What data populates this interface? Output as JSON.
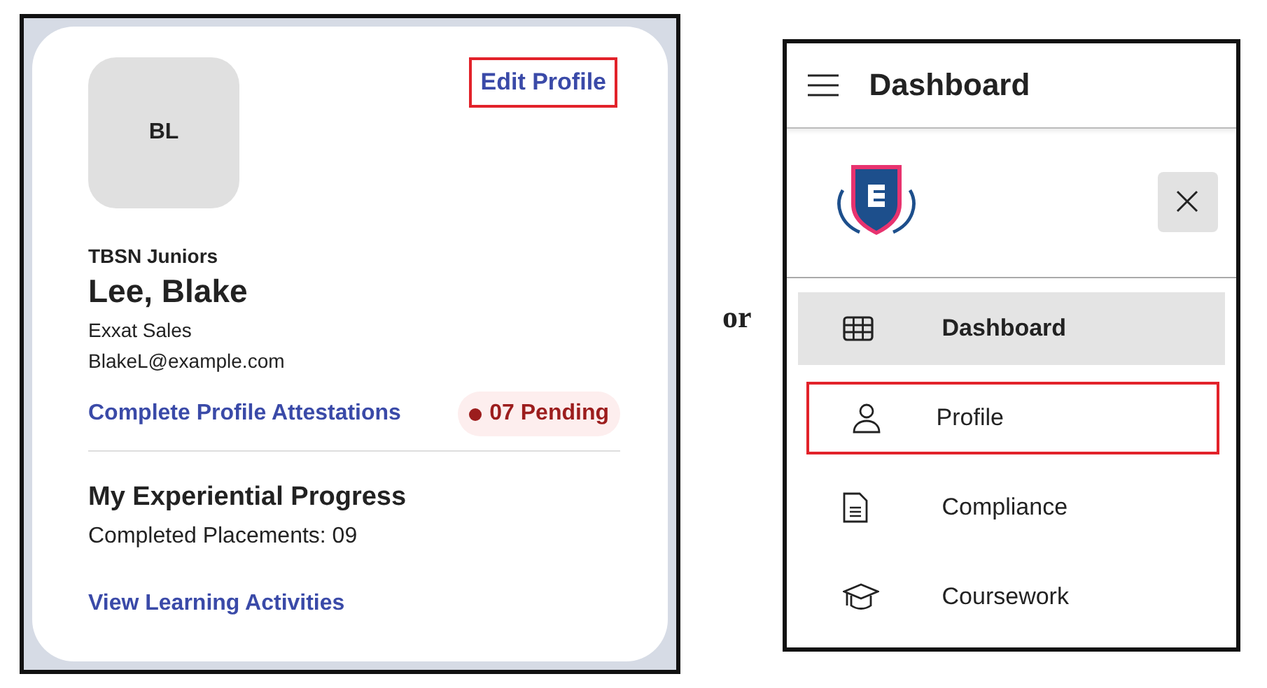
{
  "profile_card": {
    "avatar_initials": "BL",
    "edit_link": {
      "label": "Edit Profile",
      "highlighted": true
    },
    "program": "TBSN Juniors",
    "name": "Lee, Blake",
    "organization": "Exxat Sales",
    "email": "BlakeL@example.com",
    "attestations_link": "Complete Profile Attestations",
    "pending_badge": "07 Pending",
    "progress_title": "My Experiential Progress",
    "completed_placements": "Completed Placements: 09",
    "learning_link": "View Learning Activities"
  },
  "separator": "or",
  "nav_drawer": {
    "title": "Dashboard",
    "items": [
      {
        "label": "Dashboard",
        "selected": true,
        "highlighted": false
      },
      {
        "label": "Profile",
        "selected": false,
        "highlighted": true
      },
      {
        "label": "Compliance",
        "selected": false,
        "highlighted": false
      },
      {
        "label": "Coursework",
        "selected": false,
        "highlighted": false
      }
    ]
  }
}
